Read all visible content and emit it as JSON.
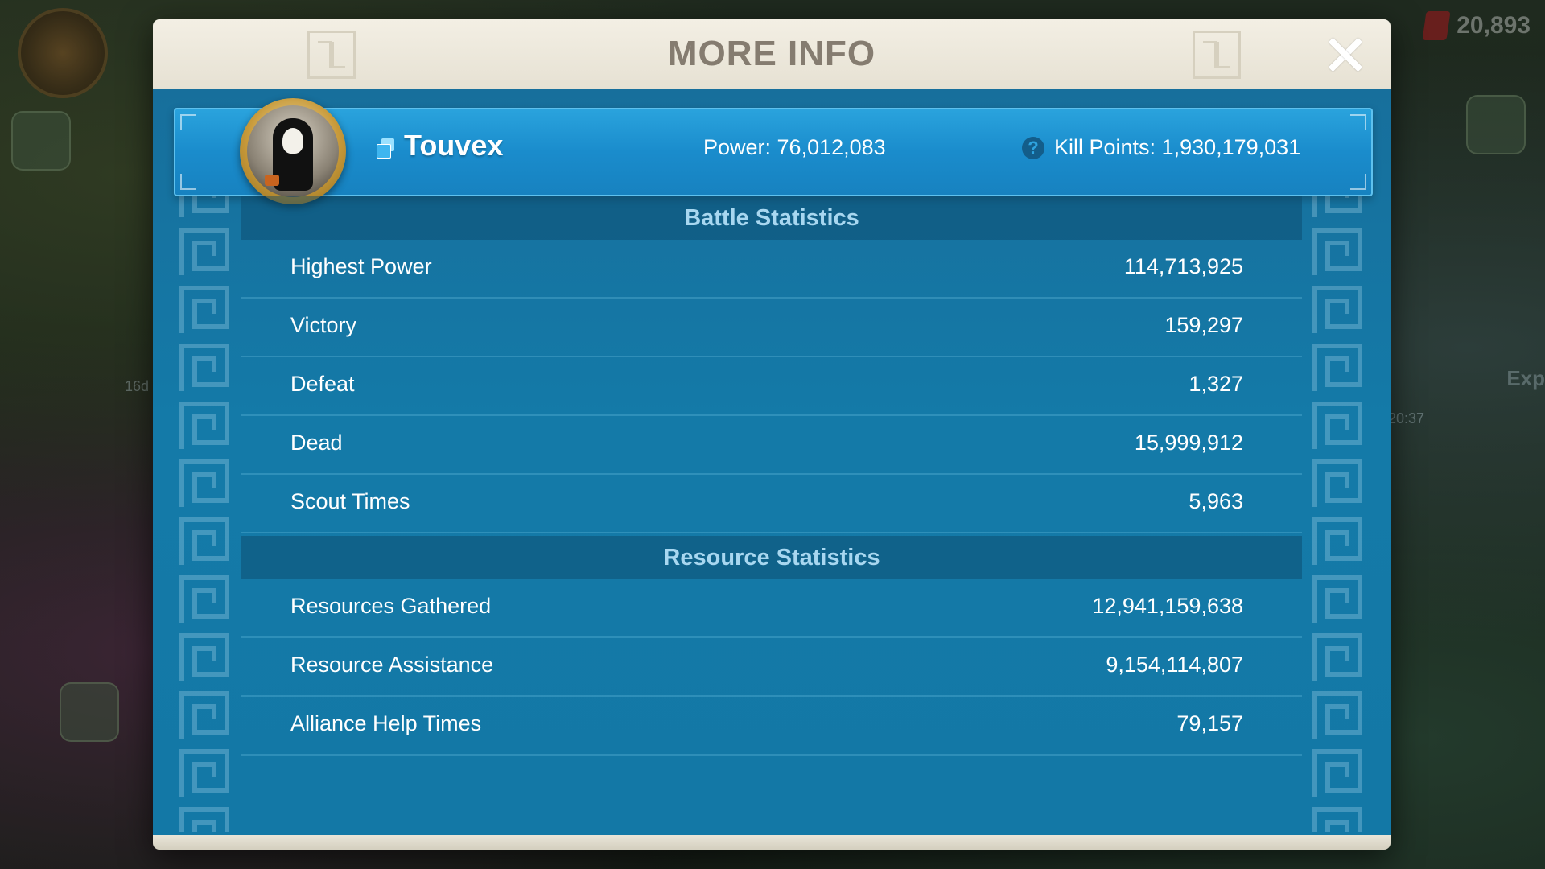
{
  "background": {
    "resource_value": "20,893",
    "timer_text": "20:37",
    "side_label": "16d",
    "edge_text": "Exp"
  },
  "modal": {
    "title": "MORE INFO",
    "close_icon": "close-icon"
  },
  "player": {
    "name": "Touvex",
    "power_text": "Power: 76,012,083",
    "kill_points_text": "Kill Points: 1,930,179,031",
    "help_icon_glyph": "?",
    "alliance_icon": "alliance-flag-icon"
  },
  "battle_statistics": {
    "title": "Battle Statistics",
    "rows": [
      {
        "label": "Highest Power",
        "value": "114,713,925"
      },
      {
        "label": "Victory",
        "value": "159,297"
      },
      {
        "label": "Defeat",
        "value": "1,327"
      },
      {
        "label": "Dead",
        "value": "15,999,912"
      },
      {
        "label": "Scout Times",
        "value": "5,963"
      }
    ]
  },
  "resource_statistics": {
    "title": "Resource Statistics",
    "rows": [
      {
        "label": "Resources Gathered",
        "value": "12,941,159,638"
      },
      {
        "label": "Resource Assistance",
        "value": "9,154,114,807"
      },
      {
        "label": "Alliance Help Times",
        "value": "79,157"
      }
    ]
  },
  "colors": {
    "panel_blue": "#1378a6",
    "banner_blue": "#1a8ccc",
    "header_cream": "#f3efe4",
    "title_gray": "#857c70",
    "section_title": "#a8d7f0"
  }
}
